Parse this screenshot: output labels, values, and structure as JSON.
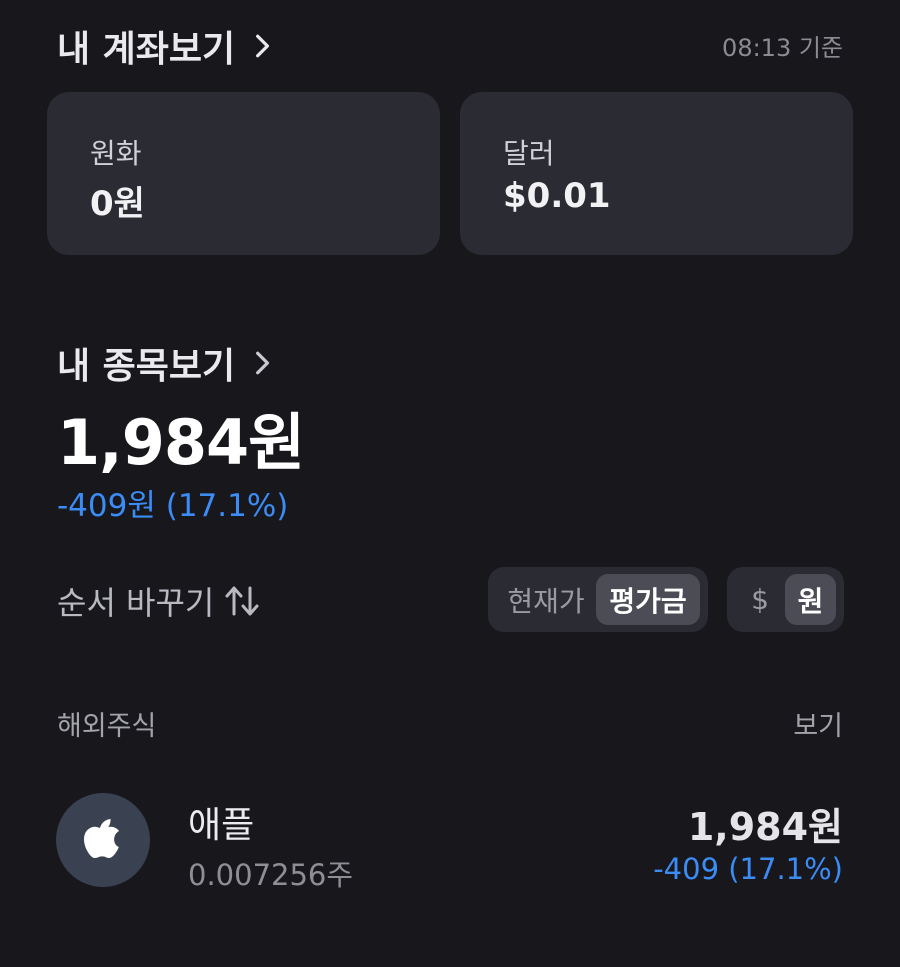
{
  "account": {
    "title": "내 계좌보기",
    "timestamp": "08:13 기준",
    "cards": [
      {
        "label": "원화",
        "value": "0원"
      },
      {
        "label": "달러",
        "value": "$0.01"
      }
    ]
  },
  "holdings": {
    "title": "내 종목보기",
    "total": "1,984원",
    "change": "-409원 (17.1%)"
  },
  "controls": {
    "sort_label": "순서 바꾸기",
    "price_toggle": {
      "current": "현재가",
      "eval": "평가금",
      "selected": "평가금"
    },
    "currency_toggle": {
      "dollar": "$",
      "won": "원",
      "selected": "원"
    }
  },
  "list": {
    "category": "해외주식",
    "view_label": "보기",
    "items": [
      {
        "name": "애플",
        "quantity": "0.007256주",
        "value": "1,984원",
        "change": "-409 (17.1%)",
        "icon": "apple-logo-icon"
      }
    ]
  },
  "colors": {
    "background": "#17171c",
    "card": "#2b2c33",
    "negative_change": "#3b8cf6"
  }
}
